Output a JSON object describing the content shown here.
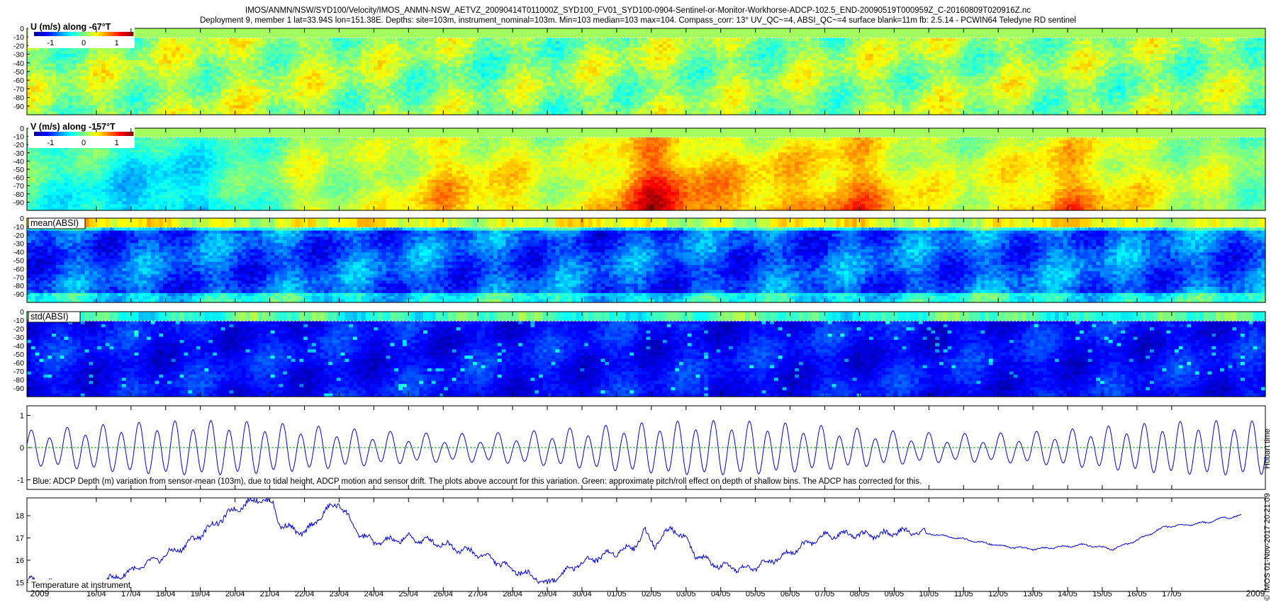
{
  "title_line1": "IMOS/ANMN/NSW/SYD100/Velocity/IMOS_ANMN-NSW_AETVZ_20090414T011000Z_SYD100_FV01_SYD100-0904-Sentinel-or-Monitor-Workhorse-ADCP-102.5_END-20090519T000959Z_C-20160809T020916Z.nc",
  "title_line2": "Deployment 9, member 1 lat=33.94S lon=151.38E. Depths: site=103m, instrument_nominal=103m. Min=103 median=103 max=104. Compass_corr: 13° UV_QC~=4, ABSI_QC~=4 surface blank=11m fb: 2.5.14 - PCWIN64 Teledyne RD sentinel",
  "side_timestamp": "Hobart time",
  "side_copyright": "© IMOS 01-Nov-2017 20:21:09",
  "colors": {
    "line_blue": "#0000e0",
    "line_green": "#00a000",
    "colormap": [
      "#00008f",
      "#0000ff",
      "#0080ff",
      "#00ffff",
      "#80ff80",
      "#ffff00",
      "#ff8000",
      "#ff0000",
      "#800000"
    ]
  },
  "chart_data": [
    {
      "type": "heatmap",
      "label": "U (m/s) along -67°T",
      "colorbar": {
        "ticks": [
          "-1",
          "0",
          "1"
        ],
        "range": [
          -1.5,
          1.5
        ]
      },
      "yticks": [
        "0",
        "-10",
        "-20",
        "-30",
        "-40",
        "-50",
        "-60",
        "-70",
        "-80",
        "-90"
      ],
      "ylim": [
        -100,
        0
      ],
      "depth_blank_m": -11,
      "field": "u_velocity",
      "time_profile": [
        {
          "day": 0,
          "value": 0.05
        },
        {
          "day": 3,
          "value": 0.1
        },
        {
          "day": 6,
          "value": 0.15
        },
        {
          "day": 10,
          "value": 0.08
        },
        {
          "day": 14,
          "value": 0.0
        },
        {
          "day": 18,
          "value": 0.1
        },
        {
          "day": 22,
          "value": 0.05
        },
        {
          "day": 26,
          "value": 0.12
        },
        {
          "day": 30,
          "value": 0.08
        },
        {
          "day": 35,
          "value": 0.05
        }
      ]
    },
    {
      "type": "heatmap",
      "label": "V (m/s) along -157°T",
      "colorbar": {
        "ticks": [
          "-1",
          "0",
          "1"
        ],
        "range": [
          -1.5,
          1.5
        ]
      },
      "yticks": [
        "0",
        "-10",
        "-20",
        "-30",
        "-40",
        "-50",
        "-60",
        "-70",
        "-80",
        "-90"
      ],
      "ylim": [
        -100,
        0
      ],
      "depth_blank_m": -11,
      "field": "v_velocity",
      "time_profile": [
        {
          "day": 0,
          "value": -0.15
        },
        {
          "day": 2,
          "value": -0.35
        },
        {
          "day": 4,
          "value": -0.55
        },
        {
          "day": 6,
          "value": -0.25
        },
        {
          "day": 8,
          "value": 0.2
        },
        {
          "day": 10,
          "value": 0.15
        },
        {
          "day": 12,
          "value": 0.55
        },
        {
          "day": 14,
          "value": 0.4
        },
        {
          "day": 16,
          "value": 0.2
        },
        {
          "day": 18,
          "value": 1.1
        },
        {
          "day": 20,
          "value": 0.6
        },
        {
          "day": 22,
          "value": 0.55
        },
        {
          "day": 24,
          "value": 0.75
        },
        {
          "day": 26,
          "value": 0.25
        },
        {
          "day": 28,
          "value": 0.3
        },
        {
          "day": 30,
          "value": 0.7
        },
        {
          "day": 32,
          "value": 0.35
        },
        {
          "day": 35,
          "value": 0.05
        }
      ]
    },
    {
      "type": "heatmap",
      "label": "mean(ABSI)",
      "yticks": [
        "0",
        "-10",
        "-20",
        "-30",
        "-40",
        "-50",
        "-60",
        "-70",
        "-80",
        "-90"
      ],
      "ylim": [
        -100,
        0
      ],
      "depth_blank_m": -11,
      "field": "mean_absi",
      "time_profile": [
        {
          "day": 0,
          "value": -0.9
        },
        {
          "day": 10,
          "value": -0.85
        },
        {
          "day": 20,
          "value": -0.9
        },
        {
          "day": 30,
          "value": -0.8
        },
        {
          "day": 35,
          "value": -0.85
        }
      ]
    },
    {
      "type": "heatmap",
      "label": "std(ABSI)",
      "yticks": [
        "0",
        "-10",
        "-20",
        "-30",
        "-40",
        "-50",
        "-60",
        "-70",
        "-80",
        "-90"
      ],
      "ylim": [
        -100,
        0
      ],
      "depth_blank_m": -11,
      "field": "std_absi",
      "time_profile": [
        {
          "day": 0,
          "value": -1.1
        },
        {
          "day": 35,
          "value": -1.1
        }
      ]
    },
    {
      "type": "line",
      "caption": "Blue: ADCP Depth (m) variation from sensor-mean (103m), due to tidal height, ADCP motion and sensor drift. The plots above account for this variation. Green: approximate pitch/roll effect on depth of shallow bins. The ADCP has corrected for this.",
      "yticks": [
        "1",
        "0",
        "-1"
      ],
      "ylim": [
        -1.3,
        1.3
      ],
      "series": [
        {
          "name": "Blue",
          "color": "#0000e0",
          "model": "tide",
          "semidiurnal_period_days": 0.5175,
          "spring_neap_period_days": 14.77,
          "mean_amplitude_m": 0.55,
          "modulation_m": 0.2,
          "diurnal_inequality_m": 0.15
        },
        {
          "name": "Green",
          "color": "#00a000",
          "value": 0.0
        }
      ]
    },
    {
      "type": "line",
      "caption": "Temperature at instrument",
      "yticks": [
        "18",
        "17",
        "16",
        "15"
      ],
      "ylim": [
        14.6,
        18.8
      ],
      "series": [
        {
          "name": "Temperature at instrument",
          "color": "#0000e0",
          "x_days_since_start": [
            0,
            1,
            2,
            3,
            3.7,
            4.5,
            5.3,
            6,
            6.7,
            7.1,
            7.3,
            8,
            8.6,
            9,
            9.5,
            10,
            10.6,
            11,
            11.8,
            12.5,
            13.2,
            14,
            14.7,
            15,
            15.3,
            16,
            16.8,
            17.5,
            17.8,
            18.1,
            18.6,
            19,
            19.3,
            20,
            20.8,
            21.5,
            22.3,
            23,
            23.7,
            24.5,
            25.2,
            26,
            26.8,
            27.5,
            28.3,
            29,
            29.8,
            30.5,
            31.3,
            32,
            32.8,
            33.5,
            34,
            34.5,
            35
          ],
          "y_celsius": [
            15.1,
            14.9,
            14.9,
            15.5,
            16.0,
            16.6,
            17.5,
            18.3,
            18.8,
            18.5,
            17.6,
            17.2,
            18.2,
            18.6,
            17.3,
            16.8,
            16.9,
            17.0,
            16.8,
            16.5,
            16.2,
            15.6,
            15.2,
            14.9,
            15.3,
            15.9,
            16.3,
            16.6,
            17.3,
            16.7,
            17.5,
            16.9,
            16.2,
            15.7,
            15.6,
            16.0,
            16.6,
            17.1,
            17.2,
            17.1,
            17.3,
            17.2,
            17.0,
            16.8,
            16.6,
            16.5,
            16.6,
            16.7,
            16.5,
            16.9,
            17.5,
            17.6,
            17.7,
            17.9,
            18.0
          ]
        }
      ]
    }
  ],
  "x_axis": {
    "ticks": [
      "16/04",
      "17/04",
      "18/04",
      "19/04",
      "20/04",
      "21/04",
      "22/04",
      "23/04",
      "24/04",
      "25/04",
      "26/04",
      "27/04",
      "28/04",
      "29/04",
      "30/04",
      "01/05",
      "02/05",
      "03/05",
      "04/05",
      "05/05",
      "06/05",
      "07/05",
      "08/05",
      "09/05",
      "10/05",
      "11/05",
      "12/05",
      "13/05",
      "14/05",
      "15/05",
      "16/05",
      "17/05"
    ],
    "year_left": "2009",
    "year_right": "2009",
    "range_start": "2009-04-14",
    "range_days": 35.7
  }
}
